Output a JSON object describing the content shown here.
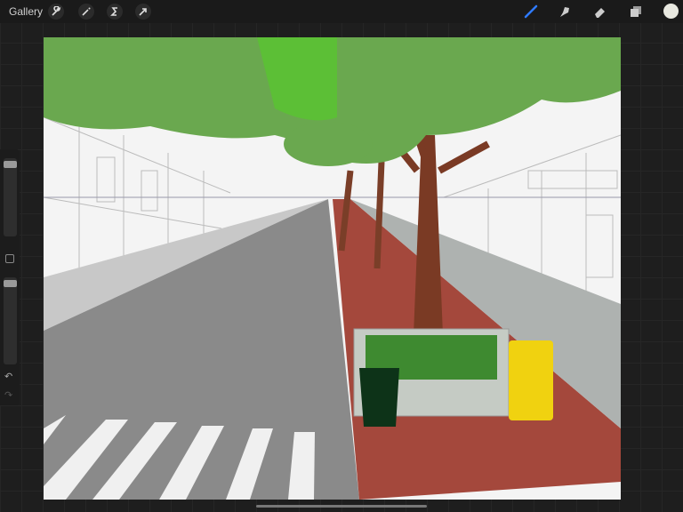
{
  "toolbar": {
    "gallery_label": "Gallery",
    "left_tools": [
      {
        "name": "actions",
        "icon": "wrench-icon",
        "glyph": "🔧"
      },
      {
        "name": "adjustments",
        "icon": "magic-wand-icon",
        "glyph": "✧"
      },
      {
        "name": "selection",
        "icon": "selection-icon",
        "glyph": "S"
      },
      {
        "name": "transform",
        "icon": "arrow-icon",
        "glyph": "➚"
      }
    ],
    "right_tools": [
      "brush-icon",
      "smudge-icon",
      "eraser-icon",
      "layers-icon",
      "color-icon"
    ],
    "colors": {
      "brush_active": "#2f7bff",
      "current_color": "#e8e8e0"
    }
  },
  "sidebar": {
    "brush_size": 0.95,
    "opacity": 0.95,
    "undo_icon": "↶",
    "redo_icon": "↷"
  }
}
